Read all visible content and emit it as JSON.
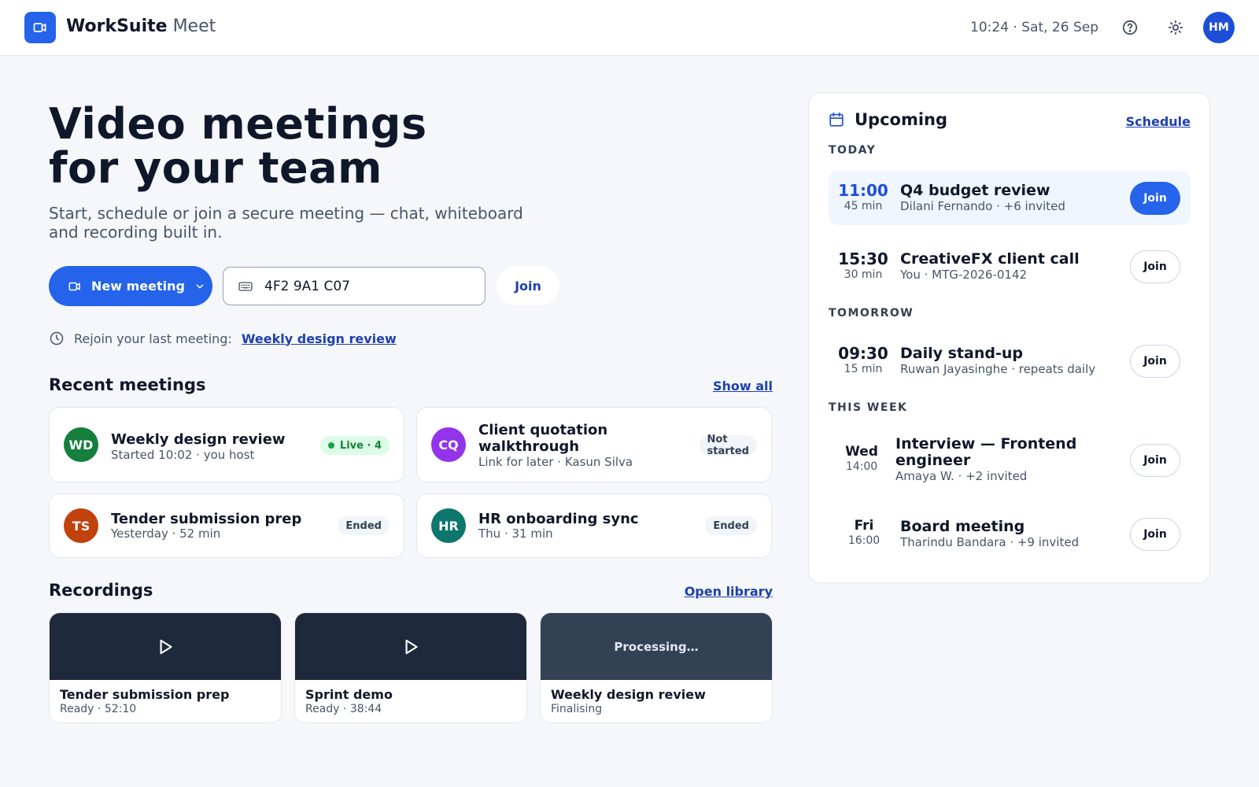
{
  "app": {
    "brand_bold": "WorkSuite",
    "brand_light": "Meet",
    "clock": "10:24 · Sat, 26 Sep",
    "user_initials": "HM"
  },
  "hero": {
    "title_line1": "Video meetings",
    "title_line2": "for your team",
    "subtitle": "Start, schedule or join a secure meeting — chat, whiteboard and recording built in.",
    "new_meeting_label": "New meeting",
    "code_value": "4F2 9A1 C07",
    "join_label": "Join",
    "rejoin_text": "Rejoin your last meeting:",
    "rejoin_link": "Weekly design review"
  },
  "recent": {
    "title": "Recent meetings",
    "show_all": "Show all",
    "items": [
      {
        "initials": "WD",
        "color": "#15803d",
        "title": "Weekly design review",
        "meta": "Started 10:02 · you host",
        "status": "Live · 4",
        "status_type": "live"
      },
      {
        "initials": "CQ",
        "color": "#9333ea",
        "title_line1": "Client quotation",
        "title_line2": "walkthrough",
        "meta": "Link for later · Kasun Silva",
        "status_line1": "Not",
        "status_line2": "started",
        "status_type": "gray"
      },
      {
        "initials": "TS",
        "color": "#c2410c",
        "title": "Tender submission prep",
        "meta": "Yesterday · 52 min",
        "status": "Ended",
        "status_type": "gray"
      },
      {
        "initials": "HR",
        "color": "#0f766e",
        "title": "HR onboarding sync",
        "meta": "Thu · 31 min",
        "status": "Ended",
        "status_type": "gray"
      }
    ]
  },
  "recordings": {
    "title": "Recordings",
    "open_library": "Open library",
    "items": [
      {
        "title": "Tender submission prep",
        "meta": "Ready · 52:10",
        "state": "ready"
      },
      {
        "title": "Sprint demo",
        "meta": "Ready · 38:44",
        "state": "ready"
      },
      {
        "title": "Weekly design review",
        "meta": "Finalising",
        "state": "processing",
        "overlay": "Processing…"
      }
    ]
  },
  "upcoming": {
    "title": "Upcoming",
    "schedule": "Schedule",
    "groups": {
      "today": "TODAY",
      "tomorrow": "TOMORROW",
      "this_week": "THIS WEEK"
    },
    "items": [
      {
        "time": "11:00",
        "duration": "45 min",
        "title": "Q4 budget review",
        "meta": "Dilani Fernando · +6 invited",
        "join": "Join"
      },
      {
        "time": "15:30",
        "duration": "30 min",
        "title": "CreativeFX client call",
        "meta": "You · MTG-2026-0142",
        "join": "Join"
      },
      {
        "time": "09:30",
        "duration": "15 min",
        "title": "Daily stand-up",
        "meta": "Ruwan Jayasinghe · repeats daily",
        "join": "Join"
      },
      {
        "day": "Wed",
        "time": "14:00",
        "title_line1": "Interview — Frontend",
        "title_line2": "engineer",
        "meta": "Amaya W. · +2 invited",
        "join": "Join"
      },
      {
        "day": "Fri",
        "time": "16:00",
        "title": "Board meeting",
        "meta": "Tharindu Bandara · +9 invited",
        "join": "Join"
      }
    ]
  },
  "colors": {
    "primary": "#2563eb",
    "link": "#1e40af",
    "live": "#16a34a",
    "thumb_dark": "#1e293b",
    "thumb_processing": "#334155"
  },
  "icons": [
    "video-camera-icon",
    "help-icon",
    "sun-icon",
    "keyboard-icon",
    "chevron-down-icon",
    "clock-icon",
    "calendar-icon",
    "play-icon"
  ]
}
